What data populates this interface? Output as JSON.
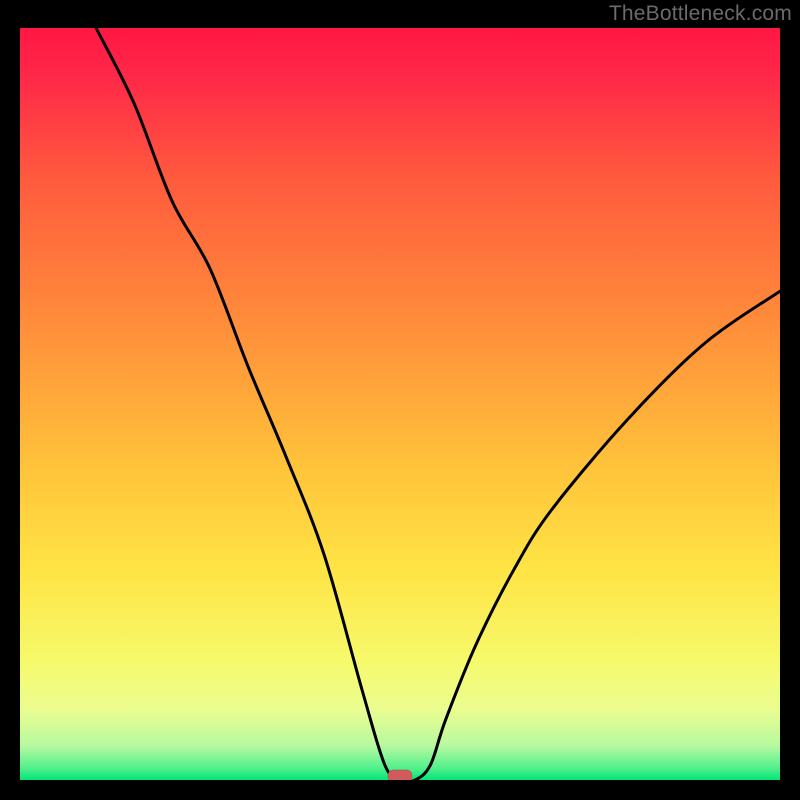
{
  "attribution": "TheBottleneck.com",
  "chart_data": {
    "type": "line",
    "title": "",
    "xlabel": "",
    "ylabel": "",
    "xlim": [
      0,
      100
    ],
    "ylim": [
      0,
      100
    ],
    "series": [
      {
        "name": "bottleneck-curve",
        "x": [
          10,
          15,
          20,
          25,
          30,
          35,
          40,
          45,
          48,
          50,
          52,
          54,
          56,
          60,
          65,
          70,
          80,
          90,
          100
        ],
        "y": [
          100,
          90,
          77,
          68,
          55,
          43,
          30,
          12,
          2,
          0,
          0,
          2,
          8,
          18,
          28,
          36,
          48,
          58,
          65
        ]
      }
    ],
    "marker": {
      "x": 50,
      "y": 0
    },
    "annotations": []
  },
  "colors": {
    "gradient_top": "#ff1744",
    "gradient_mid": "#ffd940",
    "gradient_bottom": "#00e676",
    "curve": "#000000",
    "marker": "#d15a5a",
    "background": "#000000",
    "attribution": "#6b6b6b"
  }
}
